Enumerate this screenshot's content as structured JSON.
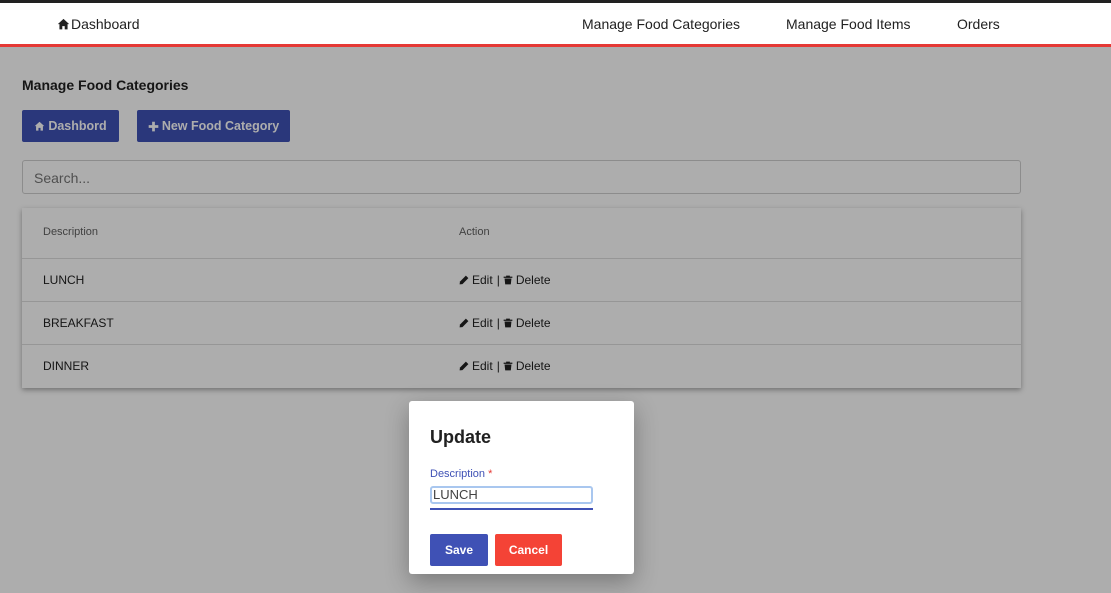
{
  "topbar": {
    "brand": "Dashboard",
    "nav": [
      "Manage Food Categories",
      "Manage Food Items",
      "Orders"
    ]
  },
  "page": {
    "title": "Manage Food Categories",
    "dashboard_button": "Dashbord",
    "new_category_button": "New Food Category",
    "search_placeholder": "Search..."
  },
  "table": {
    "headers": [
      "Description",
      "Action"
    ],
    "rows": [
      {
        "description": "LUNCH",
        "edit": "Edit",
        "delete": "Delete"
      },
      {
        "description": "BREAKFAST",
        "edit": "Edit",
        "delete": "Delete"
      },
      {
        "description": "DINNER",
        "edit": "Edit",
        "delete": "Delete"
      }
    ],
    "separator": "|"
  },
  "dialog": {
    "title": "Update",
    "label": "Description",
    "required_mark": "*",
    "value": "LUNCH",
    "save_label": "Save",
    "cancel_label": "Cancel"
  },
  "colors": {
    "primary": "#3f51b5",
    "danger": "#f44336",
    "topbar_accent": "#e53935"
  },
  "icons": [
    "home-icon",
    "plus-icon",
    "pencil-icon",
    "trash-icon"
  ]
}
